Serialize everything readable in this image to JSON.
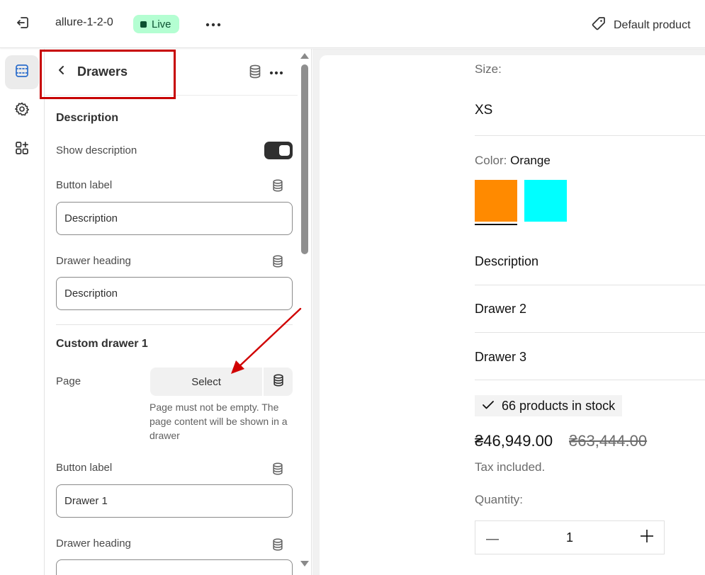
{
  "topbar": {
    "theme_name": "allure-1-2-0",
    "status_badge": "Live",
    "template_selector": "Default product"
  },
  "panel": {
    "title": "Drawers",
    "description_section": {
      "title": "Description",
      "show_description_label": "Show description",
      "show_description_enabled": true,
      "button_label_label": "Button label",
      "button_label_value": "Description",
      "drawer_heading_label": "Drawer heading",
      "drawer_heading_value": "Description"
    },
    "custom_drawer_1": {
      "title": "Custom drawer 1",
      "page_label": "Page",
      "page_select_label": "Select",
      "page_help": "Page must not be empty. The page content will be shown in a drawer",
      "button_label_label": "Button label",
      "button_label_value": "Drawer 1",
      "drawer_heading_label": "Drawer heading"
    }
  },
  "preview": {
    "size_label": "Size:",
    "size_value": "XS",
    "color_label": "Color:",
    "color_value": "Orange",
    "swatches": [
      {
        "name": "Orange",
        "color": "#ff8a00"
      },
      {
        "name": "Cyan",
        "color": "#00ffff"
      }
    ],
    "drawers": [
      "Description",
      "Drawer 2",
      "Drawer 3"
    ],
    "stock_text": "66 products in stock",
    "price": "₴46,949.00",
    "compare_price": "₴63,444.00",
    "tax_note": "Tax included.",
    "quantity_label": "Quantity:",
    "quantity_value": "1"
  },
  "colors": {
    "live_badge_bg": "#b4fed2",
    "highlight": "#c70000",
    "arrow": "#d00000"
  }
}
